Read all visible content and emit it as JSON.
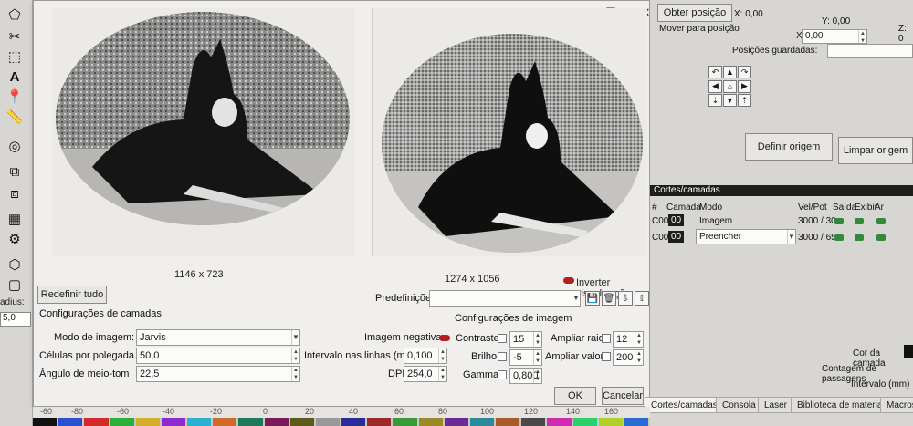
{
  "left_toolbar": {
    "radius_label": "adius:",
    "radius_value": "5,0"
  },
  "dialog": {
    "left_dimensions": "1146 x 723",
    "right_dimensions": "1274 x 1056",
    "invert_label": "Inverter visualização",
    "reset_button": "Redefinir tudo",
    "presets_label": "Predefinições",
    "layer_settings_title": "Configurações de camadas",
    "image_settings_title": "Configurações de imagem",
    "image_mode_label": "Modo de imagem:",
    "image_mode_value": "Jarvis",
    "cells_label": "Células por polegada",
    "cells_value": "50,0",
    "angle_label": "Ângulo de meio-tom",
    "angle_value": "22,5",
    "negative_label": "Imagem negativa",
    "interval_label": "Intervalo nas linhas (mm)",
    "interval_value": "0,100",
    "dpi_label": "DPI",
    "dpi_value": "254,0",
    "contrast_label": "Contraste:",
    "contrast_value": "15",
    "brightness_label": "Brilho:",
    "brightness_value": "-5",
    "gamma_label": "Gamma:",
    "gamma_value": "0,800",
    "enlarge_radius_label": "Ampliar raio:",
    "enlarge_radius_value": "12",
    "enlarge_value_label": "Ampliar valor:",
    "enlarge_value_value": "200",
    "ok_button": "OK",
    "cancel_button": "Cancelar"
  },
  "right_panel": {
    "get_position_button": "Obter posição",
    "x_readout": "X: 0,00",
    "y_readout": "Y: 0,00",
    "z_readout": "Z: 0",
    "move_to_position": "Mover para posição",
    "x_label": "X",
    "x_value": "0,00",
    "saved_positions_label": "Posições guardadas:",
    "set_origin_button": "Definir origem",
    "clear_origin_button": "Limpar origem",
    "cuts_layers_title": "Cortes/camadas",
    "table_headers": [
      "#",
      "Camada",
      "Modo",
      "Vel/Pot",
      "Saída",
      "Exibir",
      "Ar"
    ],
    "rows": [
      {
        "num": "C00",
        "layer": "00",
        "mode": "Imagem",
        "speed_power": "3000 / 30"
      },
      {
        "num": "C00",
        "layer": "00",
        "mode": "Preencher",
        "speed_power": "3000 / 65"
      }
    ],
    "layer_color_label": "Cor da camada",
    "pass_count_label": "Contagem de passagens",
    "interval_label": "Intervalo (mm)",
    "tabs": [
      "Cortes/camadas",
      "Consola",
      "Laser",
      "Biblioteca de materiais",
      "Macros"
    ]
  },
  "ruler": {
    "ticks": [
      "-60",
      "-80",
      "-60",
      "-40",
      "-20",
      "0",
      "20",
      "40",
      "60",
      "80",
      "100",
      "120",
      "140",
      "160"
    ]
  },
  "colors": {
    "accent_red": "#8a1f1f",
    "toggle_green": "#2f8a3b",
    "layer_black": "#1e1e1e"
  }
}
